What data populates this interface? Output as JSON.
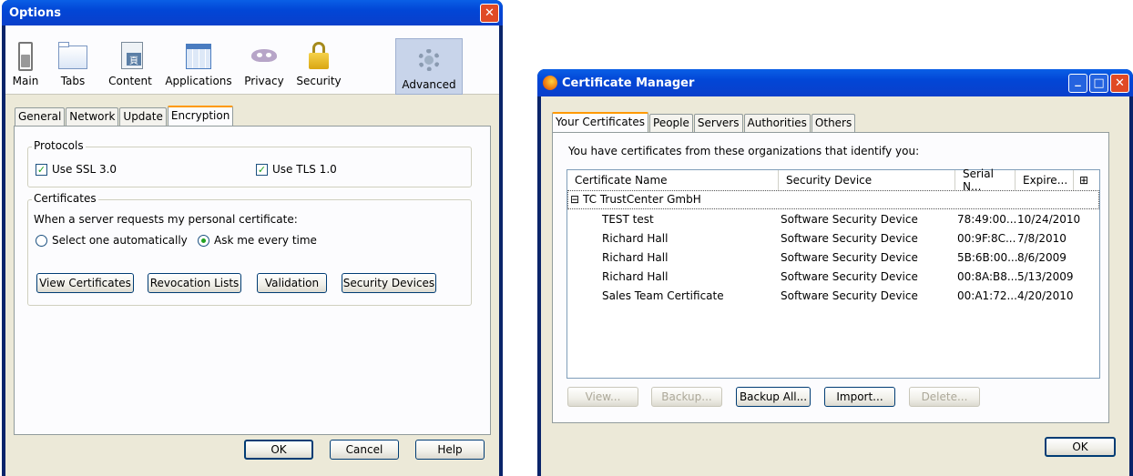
{
  "options": {
    "title": "Options",
    "close_glyph": "✕",
    "toolbar": [
      {
        "label": "Main",
        "icon": "switch-icon"
      },
      {
        "label": "Tabs",
        "icon": "tabs-icon"
      },
      {
        "label": "Content",
        "icon": "content-icon"
      },
      {
        "label": "Applications",
        "icon": "applications-icon"
      },
      {
        "label": "Privacy",
        "icon": "mask-icon"
      },
      {
        "label": "Security",
        "icon": "padlock-icon"
      },
      {
        "label": "Advanced",
        "icon": "gear-icon"
      }
    ],
    "subtabs": [
      "General",
      "Network",
      "Update",
      "Encryption"
    ],
    "protocols": {
      "label": "Protocols",
      "ssl": "Use SSL 3.0",
      "tls": "Use TLS 1.0"
    },
    "certificates": {
      "label": "Certificates",
      "prompt": "When a server requests my personal certificate:",
      "radio_auto": "Select one automatically",
      "radio_ask": "Ask me every time",
      "buttons": [
        "View Certificates",
        "Revocation Lists",
        "Validation",
        "Security Devices"
      ]
    },
    "footer": {
      "ok": "OK",
      "cancel": "Cancel",
      "help": "Help"
    }
  },
  "certmgr": {
    "title": "Certificate Manager",
    "tabs": [
      "Your Certificates",
      "People",
      "Servers",
      "Authorities",
      "Others"
    ],
    "intro": "You have certificates from these organizations that identify you:",
    "columns": [
      "Certificate Name",
      "Security Device",
      "Serial N...",
      "Expire...",
      "⊞"
    ],
    "group": "TC TrustCenter GmbH",
    "group_toggle": "⊟",
    "rows": [
      {
        "name": "TEST test",
        "device": "Software Security Device",
        "serial": "78:49:00...",
        "expires": "10/24/2010"
      },
      {
        "name": "Richard Hall",
        "device": "Software Security Device",
        "serial": "00:9F:8C...",
        "expires": "7/8/2010"
      },
      {
        "name": "Richard Hall",
        "device": "Software Security Device",
        "serial": "5B:6B:00...",
        "expires": "8/6/2009"
      },
      {
        "name": "Richard Hall",
        "device": "Software Security Device",
        "serial": "00:8A:B8...",
        "expires": "5/13/2009"
      },
      {
        "name": "Sales Team Certificate",
        "device": "Software Security Device",
        "serial": "00:A1:72...",
        "expires": "4/20/2010"
      }
    ],
    "buttons": {
      "view": "View...",
      "backup": "Backup...",
      "backup_all": "Backup All...",
      "import": "Import...",
      "delete": "Delete..."
    },
    "ok": "OK",
    "min_glyph": "_",
    "max_glyph": "□",
    "close_glyph": "✕"
  }
}
